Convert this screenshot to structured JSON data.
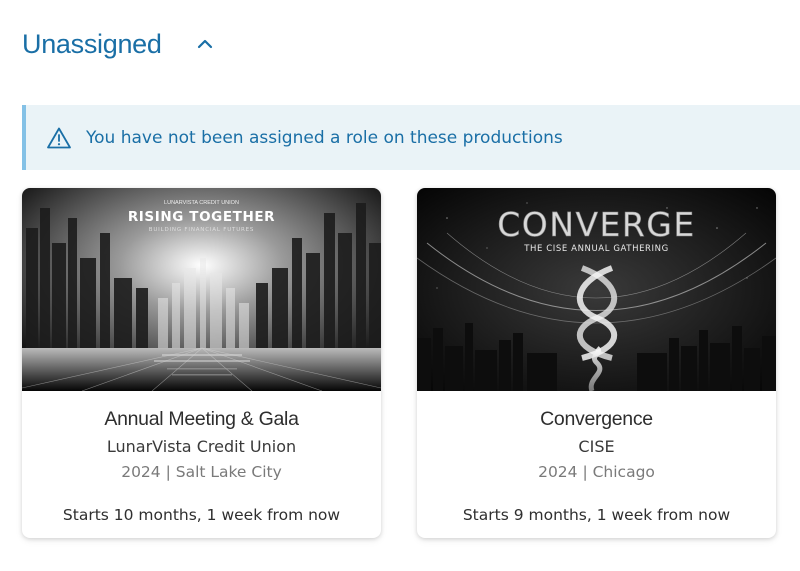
{
  "section": {
    "title": "Unassigned",
    "toggle_icon": "chevron-up-icon"
  },
  "alert": {
    "icon": "warning-triangle-icon",
    "message": "You have not been assigned a role on these productions"
  },
  "cards": [
    {
      "image": {
        "brand_line": "LUNARVISTA CREDIT UNION",
        "headline": "RISING TOGETHER",
        "subline": "BUILDING FINANCIAL FUTURES"
      },
      "title": "Annual Meeting & Gala",
      "organization": "LunarVista Credit Union",
      "meta": "2024 | Salt Lake City",
      "starts": "Starts 10 months, 1 week from now"
    },
    {
      "image": {
        "headline": "CONVERGE",
        "subline": "THE CISE ANNUAL GATHERING"
      },
      "title": "Convergence",
      "organization": "CISE",
      "meta": "2024 | Chicago",
      "starts": "Starts 9 months, 1 week from now"
    }
  ],
  "colors": {
    "accent": "#1a6fa6",
    "alert_bg": "#eaf3f7",
    "alert_border": "#84c1e6"
  }
}
